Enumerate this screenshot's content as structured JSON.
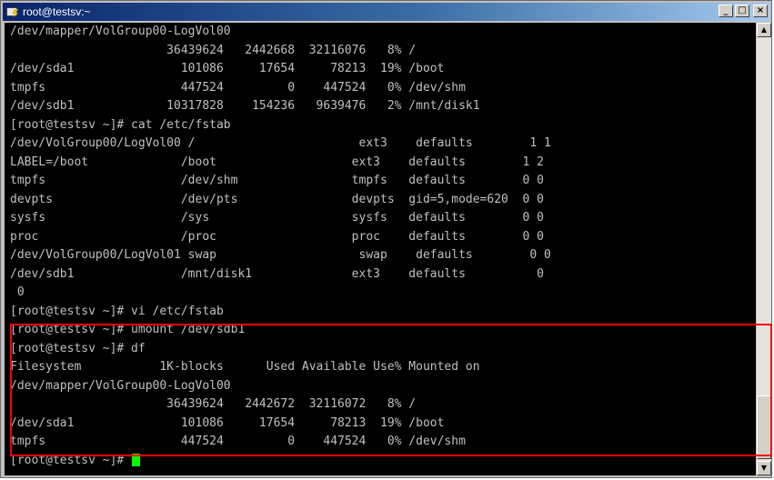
{
  "window": {
    "title": "root@testsv:~",
    "minimize_glyph": "_",
    "maximize_glyph": "□",
    "close_glyph": "×",
    "icon": "putty-icon"
  },
  "terminal": {
    "lines": [
      "/dev/mapper/VolGroup00-LogVol00",
      "                      36439624   2442668  32116076   8% /",
      "/dev/sda1               101086     17654     78213  19% /boot",
      "tmpfs                   447524         0    447524   0% /dev/shm",
      "/dev/sdb1             10317828    154236   9639476   2% /mnt/disk1",
      "[root@testsv ~]# cat /etc/fstab",
      "/dev/VolGroup00/LogVol00 /                       ext3    defaults        1 1",
      "LABEL=/boot             /boot                   ext3    defaults        1 2",
      "tmpfs                   /dev/shm                tmpfs   defaults        0 0",
      "devpts                  /dev/pts                devpts  gid=5,mode=620  0 0",
      "sysfs                   /sys                    sysfs   defaults        0 0",
      "proc                    /proc                   proc    defaults        0 0",
      "/dev/VolGroup00/LogVol01 swap                    swap    defaults        0 0",
      "/dev/sdb1               /mnt/disk1              ext3    defaults          0",
      " 0",
      "[root@testsv ~]# vi /etc/fstab",
      "[root@testsv ~]# umount /dev/sdb1",
      "[root@testsv ~]# df",
      "Filesystem           1K-blocks      Used Available Use% Mounted on",
      "/dev/mapper/VolGroup00-LogVol00",
      "                      36439624   2442672  32116072   8% /",
      "/dev/sda1               101086     17654     78213  19% /boot",
      "tmpfs                   447524         0    447524   0% /dev/shm"
    ],
    "prompt": "[root@testsv ~]# ",
    "cursor_color": "#00ff00",
    "text_color": "#c0c0c0",
    "background": "#000000"
  },
  "annotation": {
    "highlight_color": "#ff0000"
  },
  "scrollbar": {
    "up_glyph": "▲",
    "down_glyph": "▼"
  }
}
